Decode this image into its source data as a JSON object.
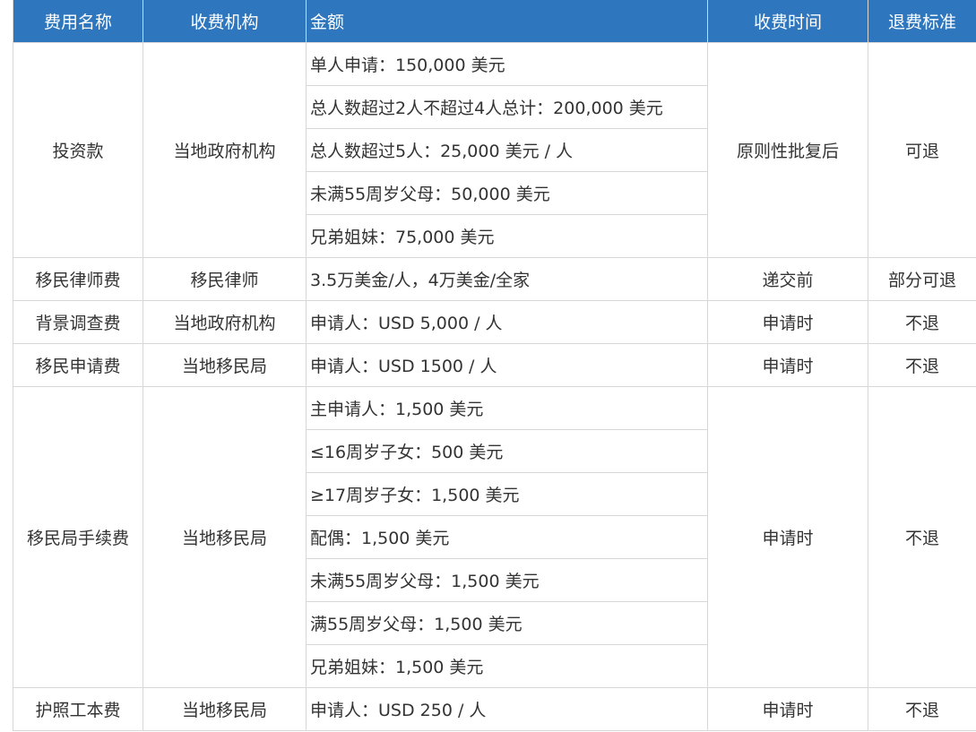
{
  "headers": {
    "name": "费用名称",
    "org": "收费机构",
    "amount": "金额",
    "time": "收费时间",
    "refund": "退费标准"
  },
  "rows": [
    {
      "name": "投资款",
      "org": "当地政府机构",
      "amounts": [
        "单人申请：150,000 美元",
        "总人数超过2人不超过4人总计：200,000 美元",
        "总人数超过5人：25,000 美元 / 人",
        "未满55周岁父母：50,000 美元",
        "兄弟姐妹：75,000 美元"
      ],
      "time": "原则性批复后",
      "refund": "可退"
    },
    {
      "name": "移民律师费",
      "org": "移民律师",
      "amounts": [
        "3.5万美金/人，4万美金/全家"
      ],
      "time": "递交前",
      "refund": "部分可退"
    },
    {
      "name": "背景调查费",
      "org": "当地政府机构",
      "amounts": [
        "申请人：USD 5,000 / 人"
      ],
      "time": "申请时",
      "refund": "不退"
    },
    {
      "name": "移民申请费",
      "org": "当地移民局",
      "amounts": [
        "申请人：USD 1500 / 人"
      ],
      "time": "申请时",
      "refund": "不退"
    },
    {
      "name": "移民局手续费",
      "org": "当地移民局",
      "amounts": [
        "主申请人：1,500 美元",
        "≤16周岁子女：500 美元",
        "≥17周岁子女：1,500 美元",
        "配偶：1,500 美元",
        "未满55周岁父母：1,500 美元",
        "满55周岁父母：1,500 美元",
        "兄弟姐妹：1,500 美元"
      ],
      "time": "申请时",
      "refund": "不退"
    },
    {
      "name": "护照工本费",
      "org": "当地移民局",
      "amounts": [
        "申请人：USD 250 / 人"
      ],
      "time": "申请时",
      "refund": "不退"
    }
  ],
  "colors": {
    "header_bg": "#2e76bd",
    "header_text": "#ffffff",
    "border": "#d7d7d7",
    "body_text": "#333333"
  }
}
